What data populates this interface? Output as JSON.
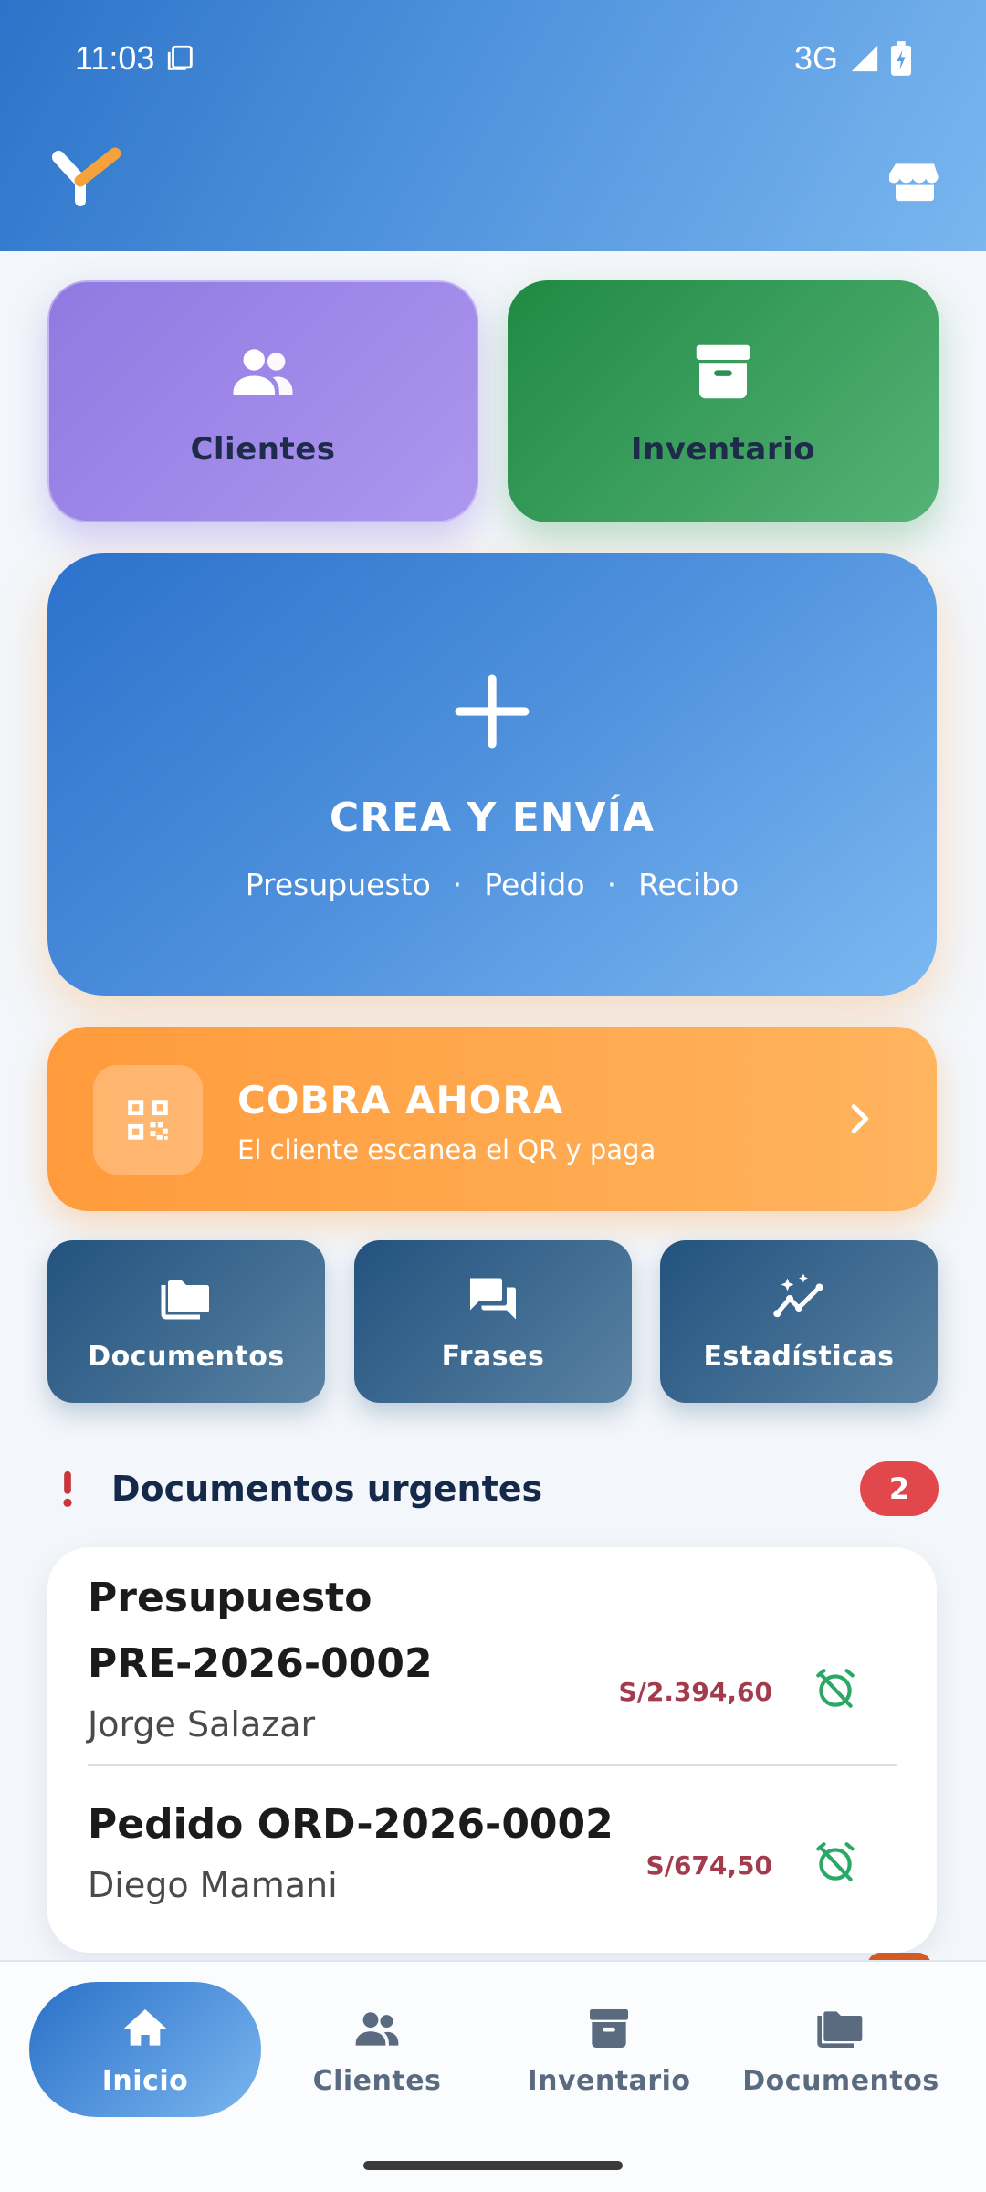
{
  "status_bar": {
    "time": "11:03",
    "network": "3G"
  },
  "tiles": {
    "clientes_label": "Clientes",
    "inventario_label": "Inventario"
  },
  "create": {
    "title": "CREA Y ENVÍA",
    "options": [
      "Presupuesto",
      "Pedido",
      "Recibo"
    ],
    "separator": "·"
  },
  "cobra": {
    "title": "COBRA AHORA",
    "subtitle": "El cliente escanea el QR y paga"
  },
  "shortcuts": [
    {
      "label": "Documentos",
      "icon": "folder-icon"
    },
    {
      "label": "Frases",
      "icon": "chat-icon"
    },
    {
      "label": "Estadísticas",
      "icon": "stats-icon"
    }
  ],
  "urgent": {
    "title": "Documentos urgentes",
    "count": "2",
    "items": [
      {
        "name_line1": "Presupuesto",
        "name_line2": "PRE-2026-0002",
        "client": "Jorge Salazar",
        "amount": "S/2.394,60"
      },
      {
        "name_line1": "Pedido ORD-2026-0002",
        "client": "Diego Mamani",
        "amount": "S/674,50"
      }
    ]
  },
  "nav": [
    {
      "label": "Inicio",
      "active": true,
      "icon": "home-icon"
    },
    {
      "label": "Clientes",
      "active": false,
      "icon": "people-icon"
    },
    {
      "label": "Inventario",
      "active": false,
      "icon": "archive-icon"
    },
    {
      "label": "Documentos",
      "active": false,
      "icon": "folder-icon"
    }
  ],
  "colors": {
    "header_start": "#2c73c9",
    "header_end": "#7ab6ef",
    "clientes_tile": "#9079e1",
    "inventario_tile": "#1f8a43",
    "cobra": "#ff9b3c",
    "shortcut_tile": "#22527e",
    "badge": "#e2474c",
    "amount": "#a23b4b",
    "alarm": "#2aa866"
  }
}
